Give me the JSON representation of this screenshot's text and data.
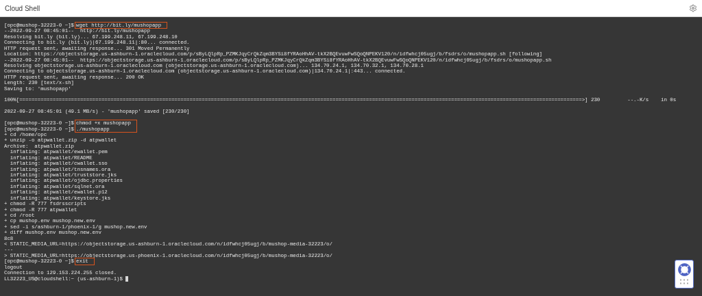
{
  "header": {
    "title": "Cloud Shell"
  },
  "terminal": {
    "lines": [
      {
        "kind": "prompt",
        "prompt": "[opc@mushop-32223-0 ~]$",
        "command": "wget http://bit.ly/mushopapp",
        "highlighted": true
      },
      {
        "kind": "output",
        "text": "--2022-09-27 08:45:01--  http://bit.ly/mushopapp"
      },
      {
        "kind": "output",
        "text": "Resolving bit.ly (bit.ly)... 67.199.248.11, 67.199.248.10"
      },
      {
        "kind": "output",
        "text": "Connecting to bit.ly (bit.ly)|67.199.248.11|:80... connected."
      },
      {
        "kind": "output",
        "text": "HTTP request sent, awaiting response... 301 Moved Permanently"
      },
      {
        "kind": "output",
        "text": "Location: https://objectstorage.us-ashburn-1.oraclecloud.com/p/sByLQlpRp_PZMKJqyCrQkZqm3BYSi8fYRAoHhAV-tkX2BQEvuwFwSQoQNPEKV120/n/idfwhcj05ugj/b/fsdrs/o/mushopapp.sh [following]"
      },
      {
        "kind": "output",
        "text": "--2022-09-27 08:45:01--  https://objectstorage.us-ashburn-1.oraclecloud.com/p/sByLQlpRp_PZMKJqyCrQkZqm3BYSi8fYRAoHhAV-tkX2BQEvuwFwSQoQNPEKV120/n/idfwhcj05ugj/b/fsdrs/o/mushopapp.sh"
      },
      {
        "kind": "output",
        "text": "Resolving objectstorage.us-ashburn-1.oraclecloud.com (objectstorage.us-ashburn-1.oraclecloud.com)... 134.70.24.1, 134.70.32.1, 134.70.28.1"
      },
      {
        "kind": "output",
        "text": "Connecting to objectstorage.us-ashburn-1.oraclecloud.com (objectstorage.us-ashburn-1.oraclecloud.com)|134.70.24.1|:443... connected."
      },
      {
        "kind": "output",
        "text": "HTTP request sent, awaiting response... 200 OK"
      },
      {
        "kind": "output",
        "text": "Length: 230 [text/x-sh]"
      },
      {
        "kind": "output",
        "text": "Saving to: 'mushopapp'"
      },
      {
        "kind": "blank"
      },
      {
        "kind": "output",
        "text": "100%[=========================================================================================================================================================================================>] 230         --.-K/s    in 0s"
      },
      {
        "kind": "blank"
      },
      {
        "kind": "output",
        "text": "2022-09-27 08:45:01 (49.1 MB/s) - 'mushopapp' saved [230/230]"
      },
      {
        "kind": "blank"
      },
      {
        "kind": "prompt",
        "prompt": "[opc@mushop-32223-0 ~]$",
        "command": "chmod +x mushopapp",
        "highlighted": true
      },
      {
        "kind": "prompt",
        "prompt": "[opc@mushop-32223-0 ~]$",
        "command": "./mushopapp",
        "highlighted": true
      },
      {
        "kind": "output",
        "text": "+ cd /home/opc"
      },
      {
        "kind": "output",
        "text": "+ unzip -o atpwallet.zip -d atpwallet"
      },
      {
        "kind": "output",
        "text": "Archive:  atpwallet.zip"
      },
      {
        "kind": "output",
        "text": "  inflating: atpwallet/ewallet.pem"
      },
      {
        "kind": "output",
        "text": "  inflating: atpwallet/README"
      },
      {
        "kind": "output",
        "text": "  inflating: atpwallet/cwallet.sso"
      },
      {
        "kind": "output",
        "text": "  inflating: atpwallet/tnsnames.ora"
      },
      {
        "kind": "output",
        "text": "  inflating: atpwallet/truststore.jks"
      },
      {
        "kind": "output",
        "text": "  inflating: atpwallet/ojdbc.properties"
      },
      {
        "kind": "output",
        "text": "  inflating: atpwallet/sqlnet.ora"
      },
      {
        "kind": "output",
        "text": "  inflating: atpwallet/ewallet.p12"
      },
      {
        "kind": "output",
        "text": "  inflating: atpwallet/keystore.jks"
      },
      {
        "kind": "output",
        "text": "+ chmod -R 777 fsdrsscripts"
      },
      {
        "kind": "output",
        "text": "+ chmod -R 777 atpwallet"
      },
      {
        "kind": "output",
        "text": "+ cd /root"
      },
      {
        "kind": "output",
        "text": "+ cp mushop.env mushop.new.env"
      },
      {
        "kind": "output",
        "text": "+ sed -i s/ashburn-1/phoenix-1/g mushop.new.env"
      },
      {
        "kind": "output",
        "text": "+ diff mushop.env mushop.new.env"
      },
      {
        "kind": "output",
        "text": "8c8"
      },
      {
        "kind": "output",
        "text": "< STATIC_MEDIA_URL=https://objectstorage.us-ashburn-1.oraclecloud.com/n/idfwhcj05ugj/b/mushop-media-32223/o/"
      },
      {
        "kind": "output",
        "text": "---"
      },
      {
        "kind": "output",
        "text": "> STATIC_MEDIA_URL=https://objectstorage.us-phoenix-1.oraclecloud.com/n/idfwhcj05ugj/b/mushop-media-32223/o/"
      },
      {
        "kind": "prompt",
        "prompt": "[opc@mushop-32223-0 ~]$",
        "command": "exit",
        "highlighted": true
      },
      {
        "kind": "output",
        "text": "logout"
      },
      {
        "kind": "output",
        "text": "Connection to 129.153.224.255 closed."
      },
      {
        "kind": "prompt",
        "prompt": "LL32223_US@cloudshell:~ (us-ashburn-1)$",
        "highlighted": false,
        "cursor": true
      }
    ]
  }
}
